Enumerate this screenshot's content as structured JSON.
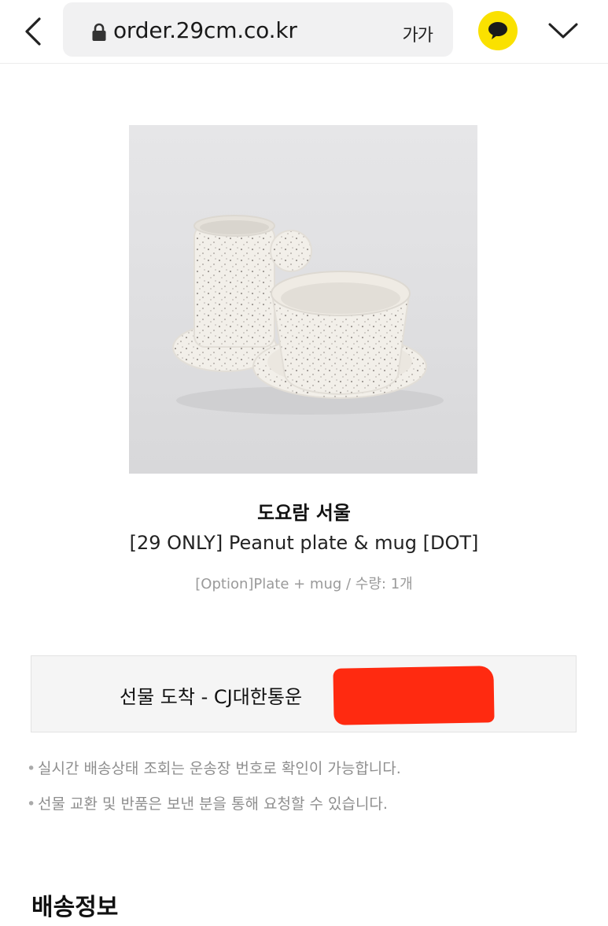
{
  "browser": {
    "url": "order.29cm.co.kr",
    "font_size_label": "가가"
  },
  "product": {
    "brand": "도요람 서울",
    "name": "[29 ONLY] Peanut plate & mug [DOT]",
    "option": "[Option]Plate + mug / 수량: 1개"
  },
  "delivery_status": {
    "text": "선물 도착 - CJ대한통운"
  },
  "notes": [
    "실시간 배송상태 조회는 운송장 번호로 확인이 가능합니다.",
    "선물 교환 및 반품은 보낸 분을 통해 요청할 수 있습니다."
  ],
  "section": {
    "shipping_title": "배송정보"
  },
  "colors": {
    "kakao_yellow": "#fae100",
    "redaction": "#ff2a10"
  },
  "icons": [
    "back-chevron-icon",
    "lock-icon",
    "kakao-talk-icon",
    "chevron-down-icon"
  ]
}
